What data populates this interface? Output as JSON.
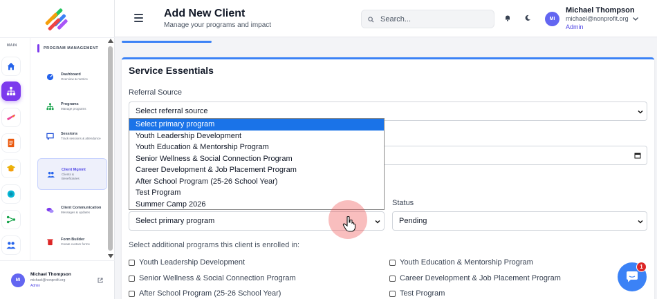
{
  "header": {
    "title": "Add New Client",
    "subtitle": "Manage your programs and impact",
    "search_placeholder": "Search...",
    "user": {
      "initials": "MI",
      "name": "Michael Thompson",
      "email": "michael@nonprofit.org",
      "role": "Admin"
    }
  },
  "sidebar": {
    "rail_label": "MAIN",
    "rail_icons": [
      "home-icon",
      "network-icon",
      "plane-icon",
      "document-icon",
      "graduation-icon",
      "globe-icon",
      "share-icon",
      "users-icon"
    ],
    "section_label": "PROGRAM MANAGEMENT",
    "items": [
      {
        "title": "Dashboard",
        "sub": "Overview & metrics"
      },
      {
        "title": "Programs",
        "sub": "Manage programs"
      },
      {
        "title": "Sessions",
        "sub": "Track sessions & attendance"
      },
      {
        "title": "Client Mgmnt",
        "sub": "Clients & Beneficiaries"
      },
      {
        "title": "Client Communication",
        "sub": "Messages & updates"
      },
      {
        "title": "Form Builder",
        "sub": "Create custom forms"
      }
    ],
    "user": {
      "initials": "MI",
      "name": "Michael Thompson",
      "email": "michael@nonprofit.org",
      "role": "Admin"
    }
  },
  "form": {
    "section_title": "Service Essentials",
    "referral_label": "Referral Source",
    "referral_value": "Select referral source",
    "status_label": "Status",
    "status_value": "Pending",
    "primary_program_value": "Select primary program",
    "dropdown_options": [
      "Select primary program",
      "Youth Leadership Development",
      "Youth Education & Mentorship Program",
      "Senior Wellness & Social Connection Program",
      "Career Development & Job Placement Program",
      "After School Program (25-26 School Year)",
      "Test Program",
      "Summer Camp 2026"
    ],
    "additional_label": "Select additional programs this client is enrolled in:",
    "checkboxes_left": [
      "Youth Leadership Development",
      "Senior Wellness & Social Connection Program",
      "After School Program (25-26 School Year)"
    ],
    "checkboxes_right": [
      "Youth Education & Mentorship Program",
      "Career Development & Job Placement Program",
      "Test Program"
    ]
  },
  "chat": {
    "badge": "1"
  },
  "colors": {
    "accent": "#7c3aed",
    "primary": "#3b82f6",
    "selected": "#1a73e8",
    "badge": "#dc2626"
  }
}
